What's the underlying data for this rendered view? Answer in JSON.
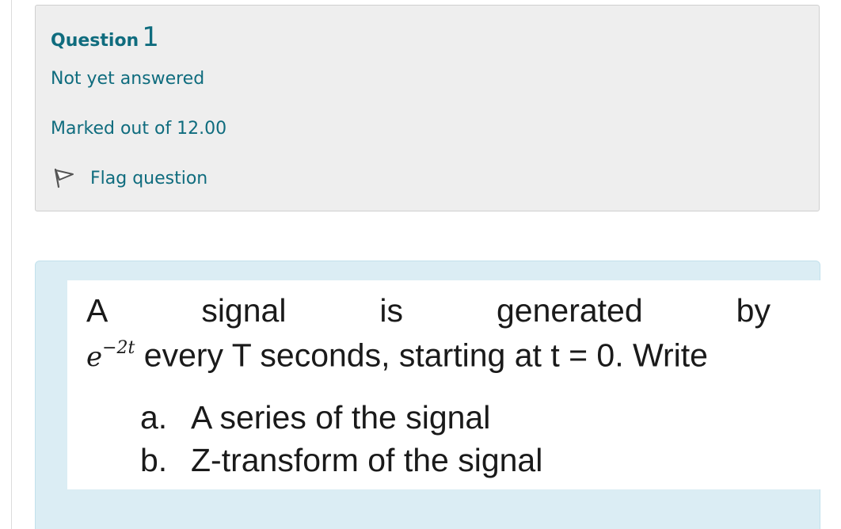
{
  "question_info": {
    "label": "Question",
    "number": "1",
    "state": "Not yet answered",
    "grade": "Marked out of 12.00",
    "flag_label": "Flag question",
    "flag_icon": "flag-outline-icon"
  },
  "question_text": {
    "line1_words": [
      "A",
      "signal",
      "is",
      "generated",
      "by"
    ],
    "math_base": "e",
    "math_exponent": "−2t",
    "line2_rest": " every T seconds, starting at t = 0. Write",
    "items": [
      {
        "marker": "a.",
        "text": "A series of the signal"
      },
      {
        "marker": "b.",
        "text": "Z-transform of the signal"
      }
    ]
  },
  "colors": {
    "link": "#0f6c7e",
    "info_bg": "#eeeeee",
    "content_bg": "#dbedf4"
  }
}
